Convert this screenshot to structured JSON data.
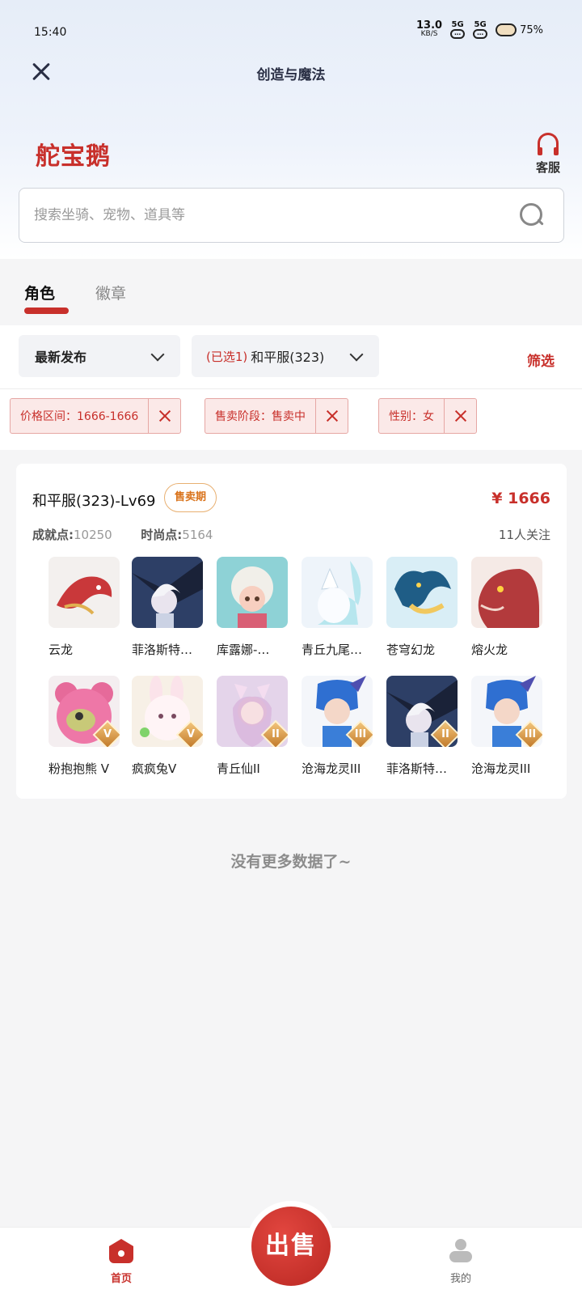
{
  "status_bar": {
    "time": "15:40",
    "net_speed": "13.0",
    "net_unit": "KB/S",
    "sim1": "5G",
    "sim2": "5G",
    "battery": "75%"
  },
  "header": {
    "title": "创造与魔法",
    "logo_text": "舵宝鹅",
    "service_label": "客服"
  },
  "search": {
    "placeholder": "搜索坐骑、宠物、道具等"
  },
  "tabs": [
    {
      "label": "角色",
      "active": true
    },
    {
      "label": "徽章",
      "active": false
    }
  ],
  "filters": {
    "sort_label": "最新发布",
    "server_selected": "(已选1)",
    "server_label": "和平服(323)",
    "filter_button": "筛选",
    "chips": [
      {
        "text": "价格区间：1666-1666"
      },
      {
        "text": "售卖阶段：售卖中"
      },
      {
        "text": "性别：女"
      }
    ]
  },
  "listing": {
    "title": "和平服(323)-Lv69",
    "badge": "售卖期",
    "price": "¥ 1666",
    "achievement_label": "成就点:",
    "achievement_value": "10250",
    "fashion_label": "时尚点:",
    "fashion_value": "5164",
    "followers": "11人关注",
    "items": [
      {
        "name": "云龙",
        "icon": "red-gold-dragon",
        "rank": ""
      },
      {
        "name": "菲洛斯特…",
        "icon": "dark-dragon-rider",
        "rank": ""
      },
      {
        "name": "库露娜-…",
        "icon": "sheep-girl",
        "rank": ""
      },
      {
        "name": "青丘九尾…",
        "icon": "white-fox",
        "rank": ""
      },
      {
        "name": "苍穹幻龙",
        "icon": "blue-dragon",
        "rank": ""
      },
      {
        "name": "熔火龙",
        "icon": "red-dragon",
        "rank": ""
      },
      {
        "name": "粉抱抱熊 V",
        "icon": "pink-bear",
        "rank": "V"
      },
      {
        "name": "疯疯兔V",
        "icon": "white-rabbit",
        "rank": "V"
      },
      {
        "name": "青丘仙II",
        "icon": "fox-girl",
        "rank": "II"
      },
      {
        "name": "沧海龙灵III",
        "icon": "blue-dragon-girl",
        "rank": "III"
      },
      {
        "name": "菲洛斯特…",
        "icon": "dark-dragon-rider",
        "rank": "II"
      },
      {
        "name": "沧海龙灵III",
        "icon": "blue-dragon-girl",
        "rank": "III"
      }
    ]
  },
  "end_text": "没有更多数据了~",
  "bottom_nav": {
    "home_label": "首页",
    "sell_label": "出售",
    "mine_label": "我的"
  },
  "colors": {
    "accent": "#c8302b",
    "badge_orange": "#d9721a"
  }
}
